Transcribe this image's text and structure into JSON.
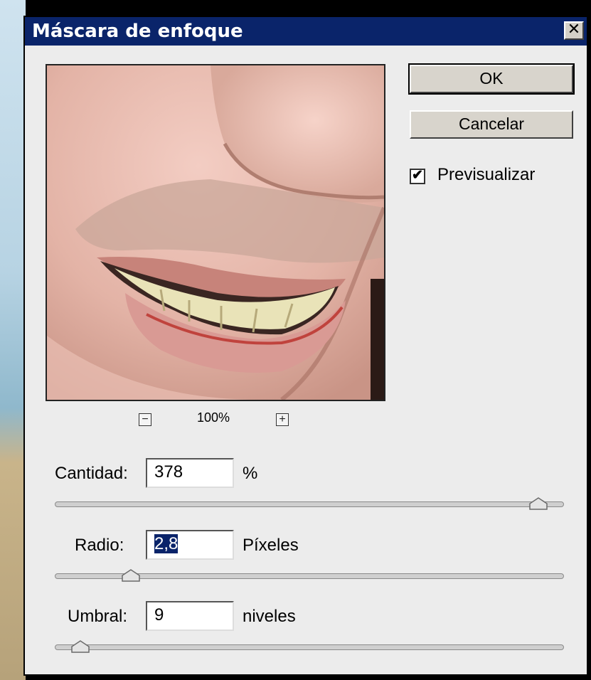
{
  "dialog": {
    "title": "Máscara de enfoque",
    "close_symbol": "✕"
  },
  "buttons": {
    "ok_label": "OK",
    "cancel_label": "Cancelar"
  },
  "preview_checkbox": {
    "label": "Previsualizar",
    "checked": true
  },
  "zoom": {
    "minus_symbol": "−",
    "plus_symbol": "+",
    "level": "100%"
  },
  "amount": {
    "label": "Cantidad:",
    "value": "378",
    "unit": "%",
    "slider_fraction": 0.95
  },
  "radius": {
    "label": "Radio:",
    "value": "2,8",
    "unit": "Píxeles",
    "slider_fraction": 0.15
  },
  "threshold": {
    "label": "Umbral:",
    "value": "9",
    "unit": "niveles",
    "slider_fraction": 0.05
  },
  "colors": {
    "titlebar": "#0a246a",
    "dialog_bg": "#ececec"
  }
}
